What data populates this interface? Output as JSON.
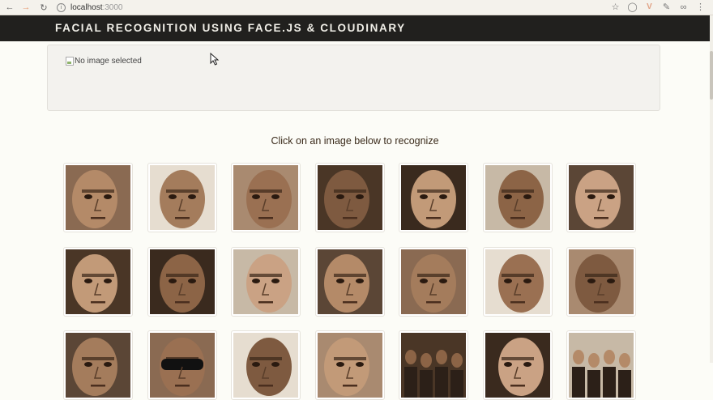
{
  "browser": {
    "host": "localhost",
    "port": ":3000"
  },
  "header": {
    "title": "FACIAL RECOGNITION USING FACE.JS & CLOUDINARY"
  },
  "preview": {
    "alt_text": "No image selected"
  },
  "instruction": "Click on an image below to recognize",
  "gallery": {
    "rows": 3,
    "columns": 7,
    "item_count": 21
  }
}
